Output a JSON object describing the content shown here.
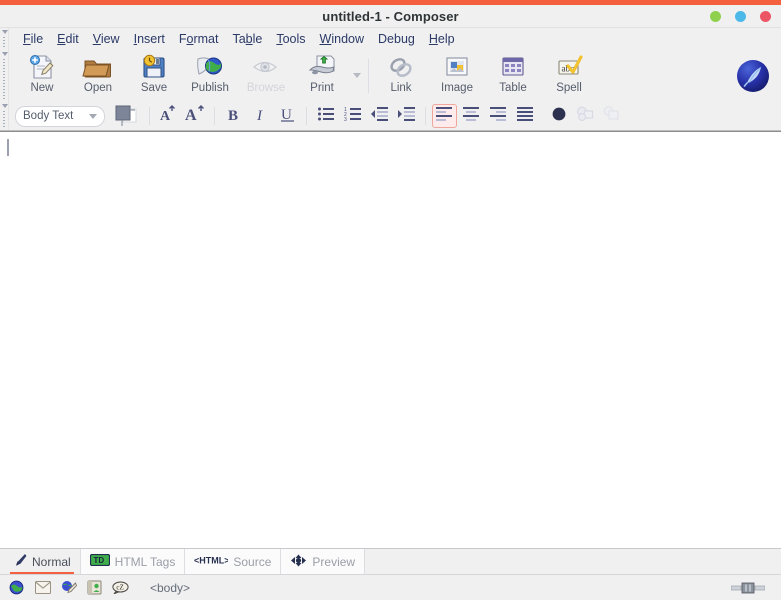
{
  "window": {
    "title": "untitled-1 - Composer",
    "accent_color": "#f4603e",
    "controls": [
      {
        "name": "minimize",
        "color": "#8fd14f"
      },
      {
        "name": "maximize",
        "color": "#4cb9e8"
      },
      {
        "name": "close",
        "color": "#ec5564"
      }
    ]
  },
  "menubar": {
    "items": [
      {
        "label": "File",
        "pre": "",
        "key": "F",
        "post": "ile"
      },
      {
        "label": "Edit",
        "pre": "",
        "key": "E",
        "post": "dit"
      },
      {
        "label": "View",
        "pre": "",
        "key": "V",
        "post": "iew"
      },
      {
        "label": "Insert",
        "pre": "",
        "key": "I",
        "post": "nsert"
      },
      {
        "label": "Format",
        "pre": "F",
        "key": "o",
        "post": "rmat"
      },
      {
        "label": "Table",
        "pre": "Ta",
        "key": "b",
        "post": "le"
      },
      {
        "label": "Tools",
        "pre": "",
        "key": "T",
        "post": "ools"
      },
      {
        "label": "Window",
        "pre": "",
        "key": "W",
        "post": "indow"
      },
      {
        "label": "Debug",
        "pre": "Debug",
        "key": "",
        "post": ""
      },
      {
        "label": "Help",
        "pre": "",
        "key": "H",
        "post": "elp"
      }
    ]
  },
  "toolbar": {
    "buttons": [
      {
        "label": "New",
        "icon": "new-document-icon",
        "enabled": true
      },
      {
        "label": "Open",
        "icon": "open-folder-icon",
        "enabled": true
      },
      {
        "label": "Save",
        "icon": "save-disk-icon",
        "enabled": true
      },
      {
        "label": "Publish",
        "icon": "publish-globe-icon",
        "enabled": true
      },
      {
        "label": "Browse",
        "icon": "browse-eye-icon",
        "enabled": false
      },
      {
        "label": "Print",
        "icon": "print-icon",
        "enabled": true
      },
      {
        "label": "Link",
        "icon": "link-chain-icon",
        "enabled": true
      },
      {
        "label": "Image",
        "icon": "image-picture-icon",
        "enabled": true
      },
      {
        "label": "Table",
        "icon": "table-grid-icon",
        "enabled": true
      },
      {
        "label": "Spell",
        "icon": "spell-check-icon",
        "enabled": true
      }
    ],
    "overflow_label": "More toolbar items",
    "brand_icon": "seamonkey-logo"
  },
  "formatbar": {
    "paragraph_style": "Body Text",
    "color_swatch": {
      "foreground": "#7d8699",
      "background": "#ffffff"
    },
    "buttons": [
      {
        "name": "increase-font-size-button",
        "icon": "font-bigger-icon",
        "active": false
      },
      {
        "name": "decrease-font-size-button",
        "icon": "font-smaller-icon",
        "active": false
      },
      {
        "name": "bold-button",
        "icon": "bold-icon",
        "active": false,
        "glyph": "B"
      },
      {
        "name": "italic-button",
        "icon": "italic-icon",
        "active": false,
        "glyph": "I"
      },
      {
        "name": "underline-button",
        "icon": "underline-icon",
        "active": false,
        "glyph": "U"
      },
      {
        "name": "bullet-list-button",
        "icon": "bullet-list-icon",
        "active": false
      },
      {
        "name": "numbered-list-button",
        "icon": "numbered-list-icon",
        "active": false
      },
      {
        "name": "outdent-button",
        "icon": "outdent-icon",
        "active": false
      },
      {
        "name": "indent-button",
        "icon": "indent-icon",
        "active": false
      },
      {
        "name": "align-left-button",
        "icon": "align-left-icon",
        "active": true
      },
      {
        "name": "align-center-button",
        "icon": "align-center-icon",
        "active": false
      },
      {
        "name": "align-right-button",
        "icon": "align-right-icon",
        "active": false
      },
      {
        "name": "align-justify-button",
        "icon": "align-justify-icon",
        "active": false
      },
      {
        "name": "text-color-button",
        "icon": "color-circle-icon",
        "active": false
      },
      {
        "name": "group-shapes-button",
        "icon": "shapes-group-icon",
        "active": false
      },
      {
        "name": "ungroup-shapes-button",
        "icon": "shapes-plain-icon",
        "active": false
      }
    ],
    "active_highlight_color": "#f0a79b"
  },
  "document": {
    "content": "",
    "caret_visible": true
  },
  "view_tabs": [
    {
      "label": "Normal",
      "icon": "pen-icon",
      "active": true
    },
    {
      "label": "HTML Tags",
      "icon": "td-tag-icon",
      "active": false
    },
    {
      "label": "Source",
      "icon": "html-angle-icon",
      "active": false
    },
    {
      "label": "Preview",
      "icon": "starburst-icon",
      "active": false
    }
  ],
  "statusbar": {
    "icons": [
      {
        "name": "navigator-globe-icon"
      },
      {
        "name": "mail-envelope-icon"
      },
      {
        "name": "composer-icon"
      },
      {
        "name": "address-book-icon"
      },
      {
        "name": "chatzilla-icon"
      }
    ],
    "element_path": "<body>",
    "grip_icon": "resize-grip-icon"
  }
}
